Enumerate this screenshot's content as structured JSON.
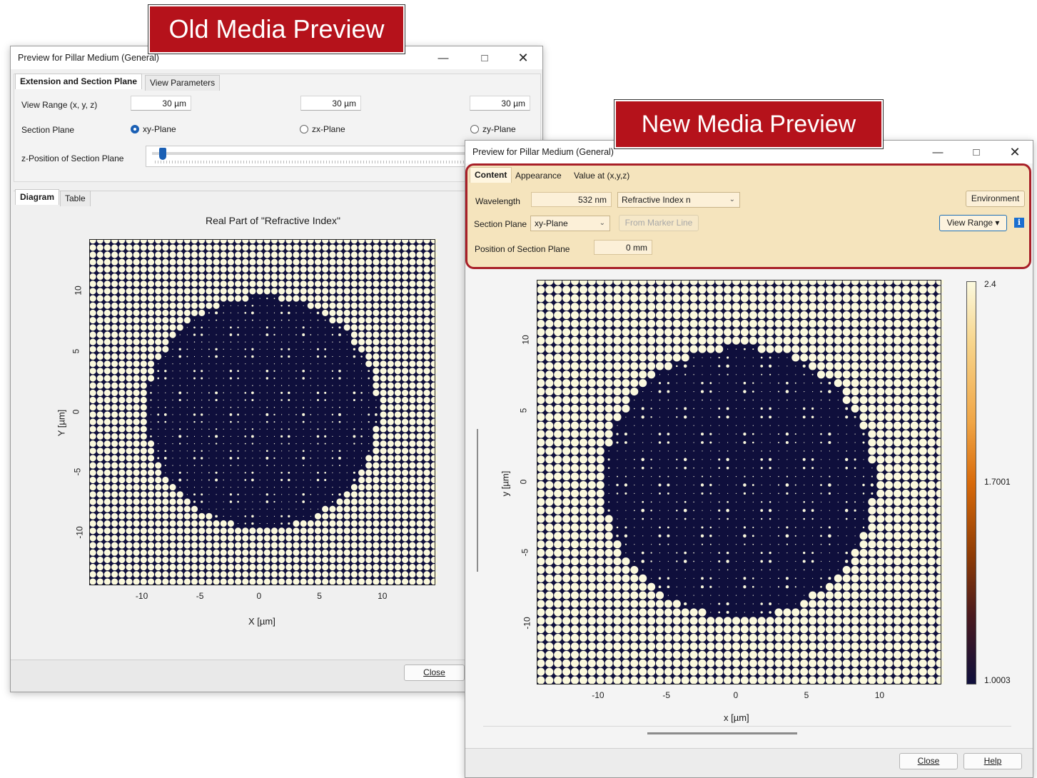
{
  "banners": {
    "old": "Old Media Preview",
    "new": "New Media Preview"
  },
  "old_window": {
    "title": "Preview for Pillar Medium (General)",
    "tabs": [
      "Extension and Section Plane",
      "View Parameters"
    ],
    "view_range_label": "View Range (x, y, z)",
    "view_range_values": [
      "30 µm",
      "30 µm",
      "30 µm"
    ],
    "section_plane_label": "Section Plane",
    "section_plane_options": [
      "xy-Plane",
      "zx-Plane",
      "zy-Plane"
    ],
    "section_plane_selected": "xy-Plane",
    "z_position_label": "z-Position of Section Plane",
    "z_position_slider_fraction": 0.02,
    "sub_tabs": [
      "Diagram",
      "Table"
    ],
    "plot_title": "Real Part of \"Refractive Index\"",
    "xlabel": "X [µm]",
    "ylabel": "Y [µm]",
    "x_ticks": [
      "-10",
      "-5",
      "0",
      "5",
      "10"
    ],
    "y_ticks": [
      "10",
      "5",
      "0",
      "-5",
      "-10"
    ],
    "close_label": "Close"
  },
  "new_window": {
    "title": "Preview for Pillar Medium (General)",
    "tabs": [
      "Content",
      "Appearance",
      "Value at (x,y,z)"
    ],
    "wavelength_label": "Wavelength",
    "wavelength_value": "532 nm",
    "quantity_select": "Refractive Index n",
    "environment_button": "Environment",
    "section_plane_label": "Section Plane",
    "section_plane_select": "xy-Plane",
    "from_marker_line": "From Marker Line",
    "view_range_button": "View Range",
    "position_label": "Position of Section Plane",
    "position_value": "0 mm",
    "xlabel": "x [µm]",
    "ylabel": "y [µm]",
    "x_ticks": [
      "-10",
      "-5",
      "0",
      "5",
      "10"
    ],
    "y_ticks": [
      "10",
      "5",
      "0",
      "-5",
      "-10"
    ],
    "colorbar_labels": [
      "2.4",
      "1.7001",
      "1.0003"
    ],
    "close_label": "Close",
    "help_label": "Help"
  },
  "chart_data": {
    "type": "heatmap",
    "quantity": "Refractive Index n",
    "xlim": [
      -14.3,
      14.3
    ],
    "ylim": [
      -14.3,
      14.3
    ],
    "colorbar_range": [
      1.0003,
      2.4
    ],
    "colors": {
      "low": "#0f0f3c",
      "high": "#fbf9de",
      "mid": "#e8820a"
    }
  }
}
